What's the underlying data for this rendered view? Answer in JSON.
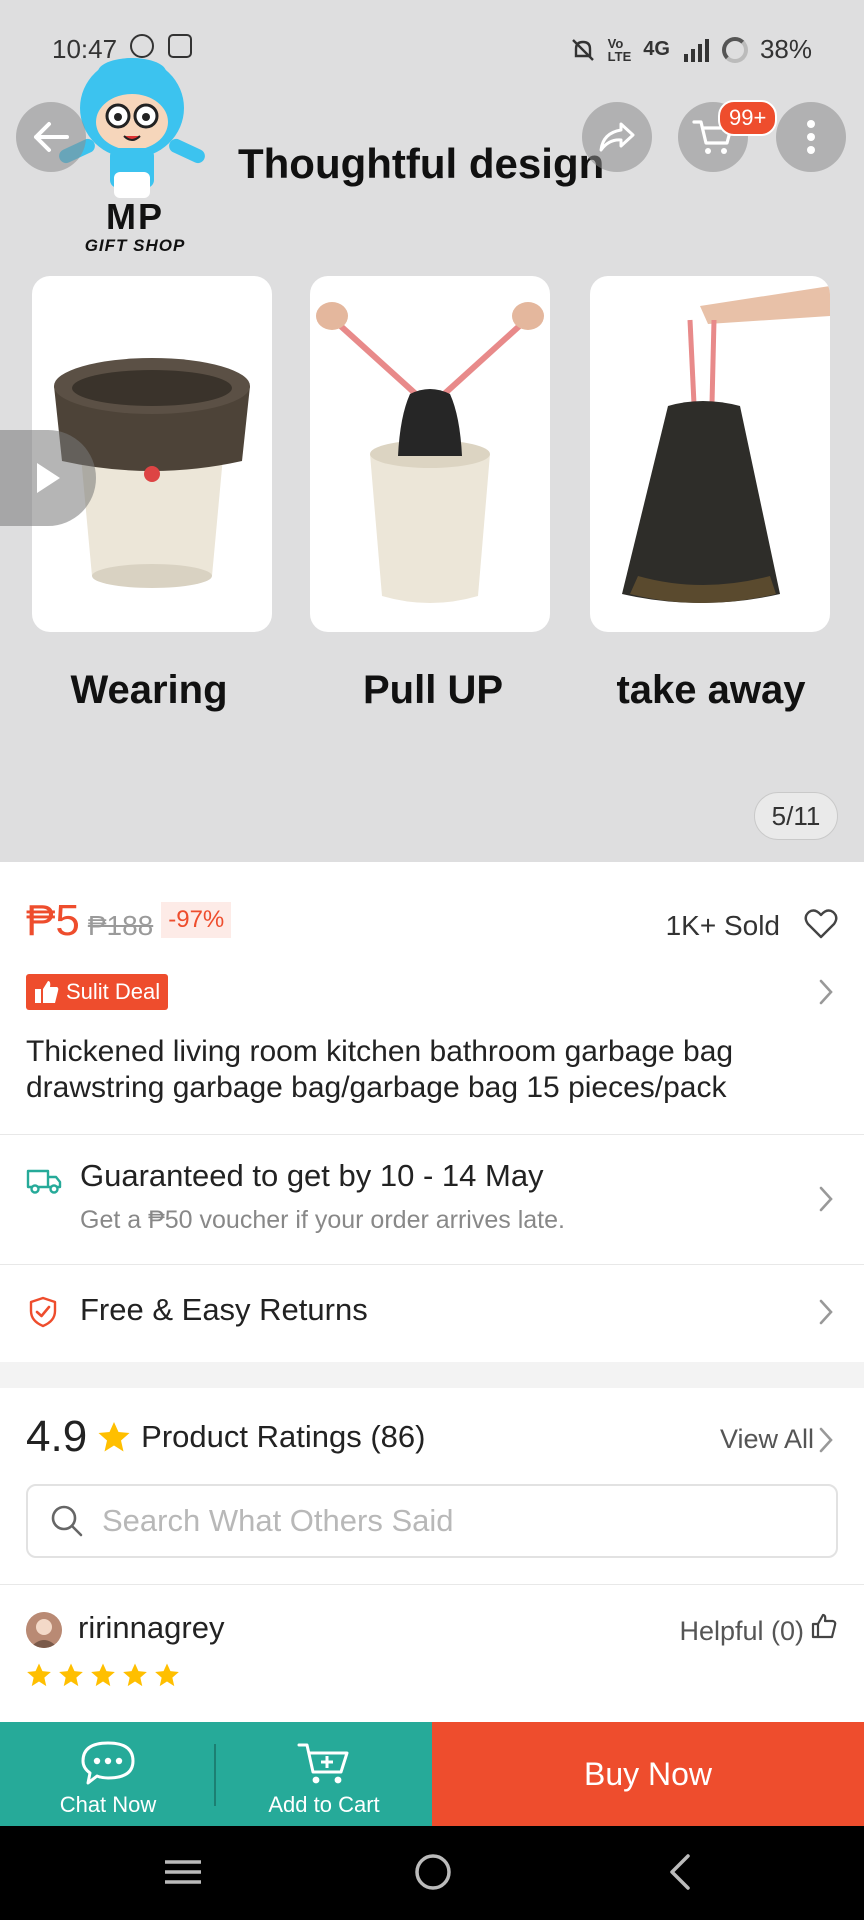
{
  "status_bar": {
    "time": "10:47",
    "network": "4G",
    "battery": "38%",
    "icons": [
      "notification-icon",
      "gallery-icon",
      "mute-icon",
      "volte-icon",
      "signal-icon",
      "battery-icon"
    ]
  },
  "header": {
    "cart_badge": "99+",
    "icons": [
      "back-arrow-icon",
      "share-icon",
      "cart-icon",
      "more-vertical-icon"
    ]
  },
  "hero": {
    "shop_logo_text": "MP",
    "shop_logo_sub": "GIFT SHOP",
    "title": "Thoughtful design",
    "panels": [
      {
        "label": "Wearing"
      },
      {
        "label": "Pull UP"
      },
      {
        "label": "take away"
      }
    ],
    "page_indicator": "5/11"
  },
  "product": {
    "price": "₱5",
    "original_price": "₱188",
    "discount": "-97%",
    "sold": "1K+ Sold",
    "deal_badge": "Sulit Deal",
    "title": "Thickened living room kitchen bathroom garbage bag drawstring garbage bag/garbage bag 15 pieces/pack"
  },
  "shipping": {
    "title": "Guaranteed to get by 10 - 14 May",
    "subtitle": "Get a ₱50 voucher if your order arrives late."
  },
  "returns": {
    "label": "Free & Easy Returns"
  },
  "ratings": {
    "score": "4.9",
    "label": "Product Ratings (86)",
    "view_all": "View All",
    "search_placeholder": "Search What Others Said"
  },
  "review": {
    "username": "ririnnagrey",
    "helpful": "Helpful (0)",
    "stars": 5
  },
  "bottom_bar": {
    "chat_label": "Chat Now",
    "cart_label": "Add to Cart",
    "buy_label": "Buy Now"
  },
  "colors": {
    "accent": "#ee4d2d",
    "teal": "#26aa99",
    "star": "#ffbf00"
  }
}
